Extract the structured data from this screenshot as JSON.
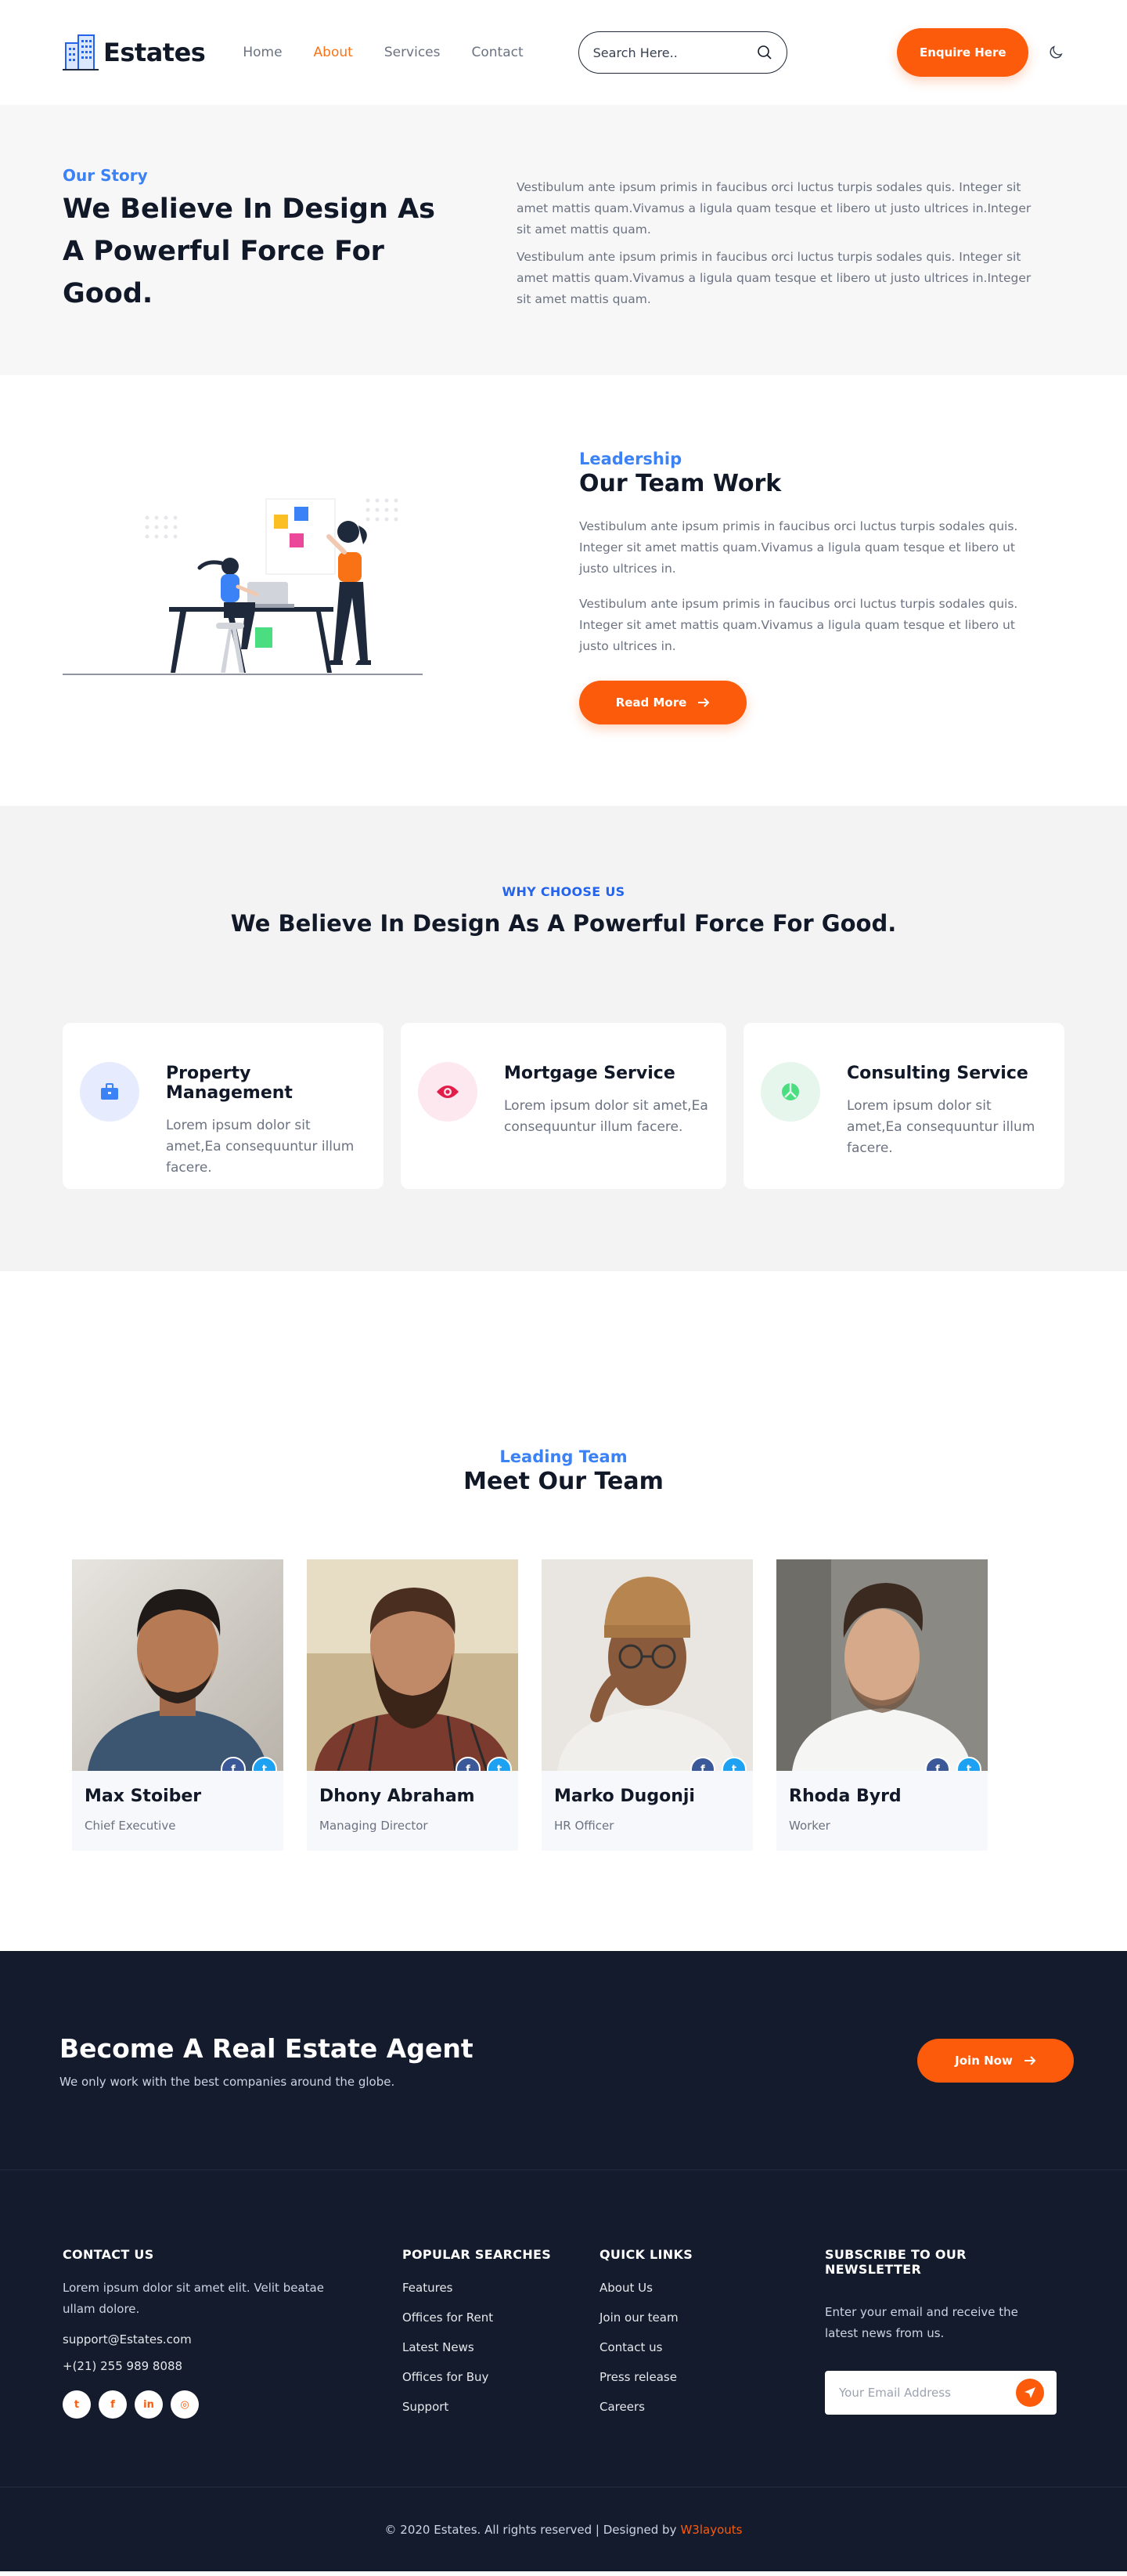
{
  "header": {
    "logo_text": "Estates",
    "nav": [
      {
        "label": "Home",
        "active": false
      },
      {
        "label": "About",
        "active": true
      },
      {
        "label": "Services",
        "active": false
      },
      {
        "label": "Contact",
        "active": false
      }
    ],
    "search_placeholder": "Search Here..",
    "enquire_label": "Enquire Here"
  },
  "story": {
    "eyebrow": "Our Story",
    "title": "We Believe In Design As A Powerful Force For Good.",
    "paragraphs": [
      "Vestibulum ante ipsum primis in faucibus orci luctus turpis sodales quis. Integer sit amet mattis quam.Vivamus a ligula quam tesque et libero ut justo ultrices in.Integer sit amet mattis quam.",
      "Vestibulum ante ipsum primis in faucibus orci luctus turpis sodales quis. Integer sit amet mattis quam.Vivamus a ligula quam tesque et libero ut justo ultrices in.Integer sit amet mattis quam."
    ]
  },
  "teamwork": {
    "eyebrow": "Leadership",
    "title": "Our Team Work",
    "paragraphs": [
      "Vestibulum ante ipsum primis in faucibus orci luctus turpis sodales quis. Integer sit amet mattis quam.Vivamus a ligula quam tesque et libero ut justo ultrices in.",
      "Vestibulum ante ipsum primis in faucibus orci luctus turpis sodales quis. Integer sit amet mattis quam.Vivamus a ligula quam tesque et libero ut justo ultrices in."
    ],
    "button_label": "Read More"
  },
  "why": {
    "eyebrow": "WHY CHOOSE US",
    "title": "We Believe In Design As A Powerful Force For Good.",
    "cards": [
      {
        "icon": "briefcase-icon",
        "title": "Property Management",
        "text": "Lorem ipsum dolor sit amet,Ea consequuntur illum facere."
      },
      {
        "icon": "eye-icon",
        "title": "Mortgage Service",
        "text": "Lorem ipsum dolor sit amet,Ea consequuntur illum facere."
      },
      {
        "icon": "peace-icon",
        "title": "Consulting Service",
        "text": "Lorem ipsum dolor sit amet,Ea consequuntur illum facere."
      }
    ]
  },
  "meet": {
    "eyebrow": "Leading Team",
    "title": "Meet Our Team",
    "members": [
      {
        "name": "Max Stoiber",
        "role": "Chief Executive"
      },
      {
        "name": "Dhony Abraham",
        "role": "Managing Director"
      },
      {
        "name": "Marko Dugonji",
        "role": "HR Officer"
      },
      {
        "name": "Rhoda Byrd",
        "role": "Worker"
      }
    ]
  },
  "agent": {
    "title": "Become A Real Estate Agent",
    "subtitle": "We only work with the best companies around the globe.",
    "button_label": "Join Now"
  },
  "footer": {
    "contact": {
      "heading": "CONTACT US",
      "text": "Lorem ipsum dolor sit amet elit. Velit beatae ullam dolore.",
      "email": "support@Estates.com",
      "phone": "+(21) 255 989 8088"
    },
    "popular": {
      "heading": "POPULAR SEARCHES",
      "links": [
        "Features",
        "Offices for Rent",
        "Latest News",
        "Offices for Buy",
        "Support"
      ]
    },
    "quick": {
      "heading": "QUICK LINKS",
      "links": [
        "About Us",
        "Join our team",
        "Contact us",
        "Press release",
        "Careers"
      ]
    },
    "newsletter": {
      "heading": "SUBSCRIBE TO OUR NEWSLETTER",
      "text": "Enter your email and receive the latest news from us.",
      "placeholder": "Your Email Address"
    }
  },
  "copyright": {
    "text": "© 2020 Estates. All rights reserved | Designed by",
    "brand": "W3layouts"
  },
  "colors": {
    "accent": "#fb5b0b",
    "link_blue": "#3b82f6",
    "dark_bg": "#141b2d"
  }
}
